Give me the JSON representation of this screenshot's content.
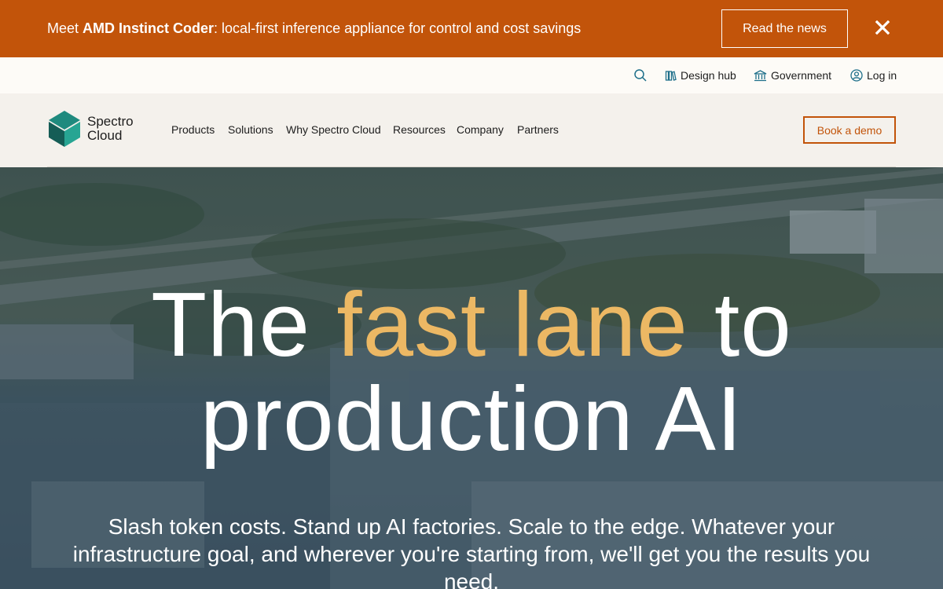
{
  "announcement": {
    "prefix": "Meet ",
    "product": "AMD Instinct Coder",
    "suffix": ": local-first inference appliance for control and cost savings",
    "cta": "Read the news",
    "close_icon": "close-icon"
  },
  "utility": {
    "search_icon": "search-icon",
    "items": [
      {
        "label": "Design hub",
        "icon": "books-icon"
      },
      {
        "label": "Government",
        "icon": "building-icon"
      },
      {
        "label": "Log in",
        "icon": "user-icon"
      }
    ]
  },
  "logo": {
    "line1": "Spectro",
    "line2": "Cloud"
  },
  "nav": {
    "items": [
      "Products",
      "Solutions",
      "Why Spectro Cloud",
      "Resources",
      "Company",
      "Partners"
    ],
    "cta": "Book a demo"
  },
  "hero": {
    "title_part1": "The ",
    "title_accent": "fast lane",
    "title_part2": " to",
    "title_line2": "production AI",
    "subtitle": "Slash token costs. Stand up AI factories. Scale to the edge. Whatever your infrastructure goal, and wherever you're starting from, we'll get you the results you need."
  },
  "colors": {
    "announcement_bg": "#c2540a",
    "accent": "#ecb864",
    "brand_teal": "#1f8a7e"
  }
}
